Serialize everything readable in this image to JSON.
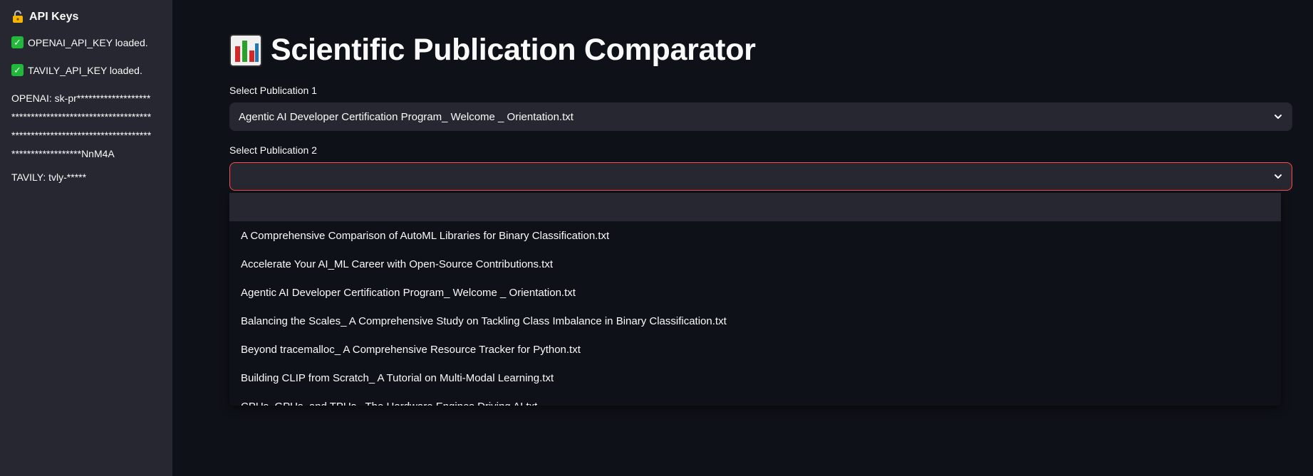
{
  "sidebar": {
    "title": "API Keys",
    "status": [
      "OPENAI_API_KEY loaded.",
      "TAVILY_API_KEY loaded."
    ],
    "openai_key": "OPENAI: sk-pr*************************************************************************************************************NnM4A",
    "tavily_key": "TAVILY: tvly-*****"
  },
  "main": {
    "title": "Scientific Publication Comparator",
    "select1": {
      "label": "Select Publication 1",
      "value": "Agentic AI Developer Certification Program_ Welcome _ Orientation.txt"
    },
    "select2": {
      "label": "Select Publication 2",
      "value": ""
    },
    "options": [
      "",
      "A Comprehensive Comparison of AutoML Libraries for Binary Classification.txt",
      "Accelerate Your AI_ML Career with Open-Source Contributions.txt",
      "Agentic AI Developer Certification Program_ Welcome _ Orientation.txt",
      "Balancing the Scales_ A Comprehensive Study on Tackling Class Imbalance in Binary Classification.txt",
      "Beyond tracemalloc_ A Comprehensive Resource Tracker for Python.txt",
      "Building CLIP from Scratch_ A Tutorial on Multi-Modal Learning.txt",
      "CPUs, GPUs, and TPUs_ The Hardware Engines Driving AI.txt"
    ]
  },
  "colors": {
    "background": "#0e1117",
    "sidebar": "#262730",
    "accent_border": "#ff4b4b",
    "check": "#21b93a"
  }
}
